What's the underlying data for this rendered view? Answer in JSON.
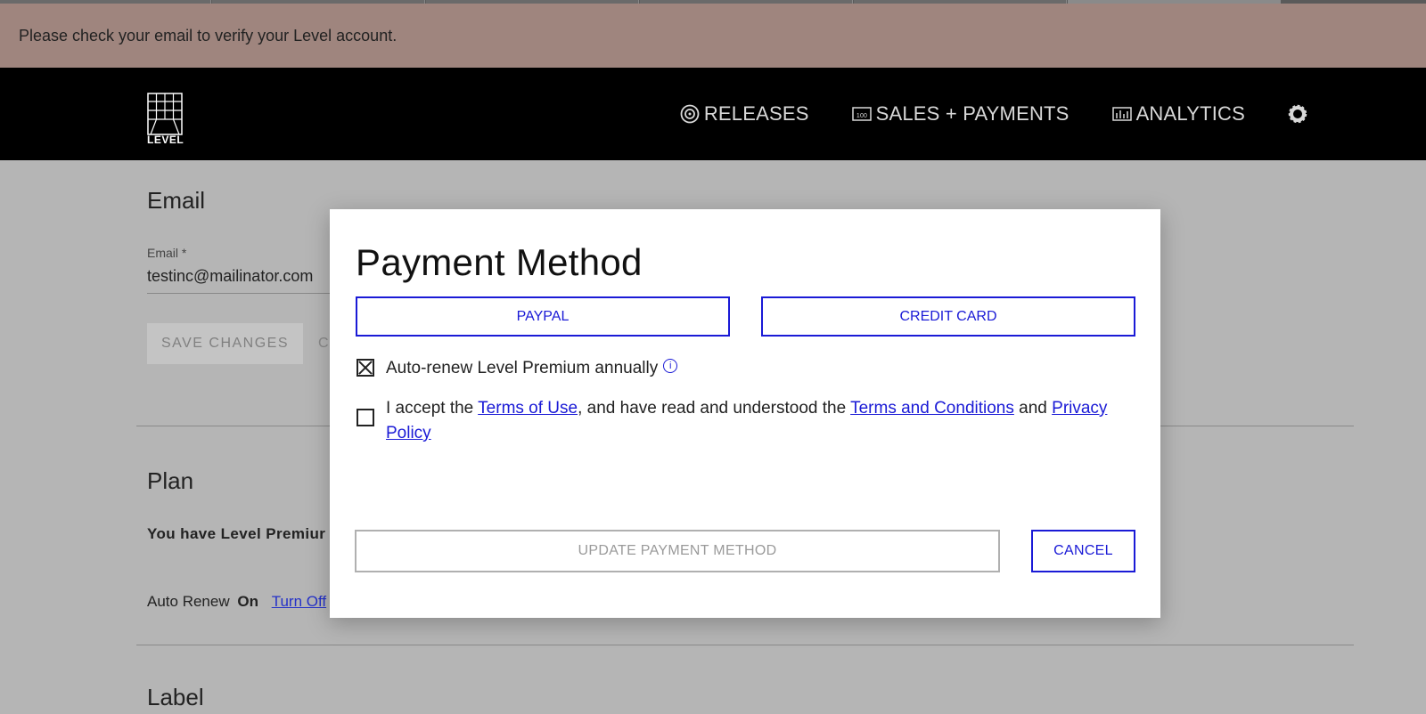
{
  "notice": {
    "text": "Please check your email to verify your Level account."
  },
  "nav": {
    "logo_text": "LEVEL",
    "links": [
      {
        "label": "RELEASES",
        "icon": "disc-icon"
      },
      {
        "label": "SALES + PAYMENTS",
        "icon": "sales-icon"
      },
      {
        "label": "ANALYTICS",
        "icon": "analytics-icon"
      }
    ],
    "settings_icon": "gear-icon"
  },
  "email_section": {
    "title": "Email",
    "field_label": "Email *",
    "field_value": "testinc@mailinator.com",
    "save_label": "SAVE CHANGES",
    "cancel_label": "CA"
  },
  "plan_section": {
    "title": "Plan",
    "description": "You have Level Premiur",
    "auto_renew_label": "Auto Renew",
    "auto_renew_state": "On",
    "turn_off_link": "Turn Off"
  },
  "label_section": {
    "title": "Label"
  },
  "modal": {
    "title": "Payment Method",
    "paypal_label": "PAYPAL",
    "credit_card_label": "CREDIT CARD",
    "auto_renew_text": "Auto-renew Level Premium annually",
    "auto_renew_checked": true,
    "terms": {
      "prefix": "I accept the ",
      "terms_of_use": "Terms of Use",
      "middle": ", and have read and understood the ",
      "terms_conditions": "Terms and Conditions",
      "and": " and ",
      "privacy_policy": "Privacy Policy",
      "checked": false
    },
    "update_label": "UPDATE PAYMENT METHOD",
    "cancel_label": "CANCEL"
  },
  "colors": {
    "accent": "#1a1ad6",
    "notice_bg": "#9f857e",
    "nav_bg": "#000000"
  }
}
